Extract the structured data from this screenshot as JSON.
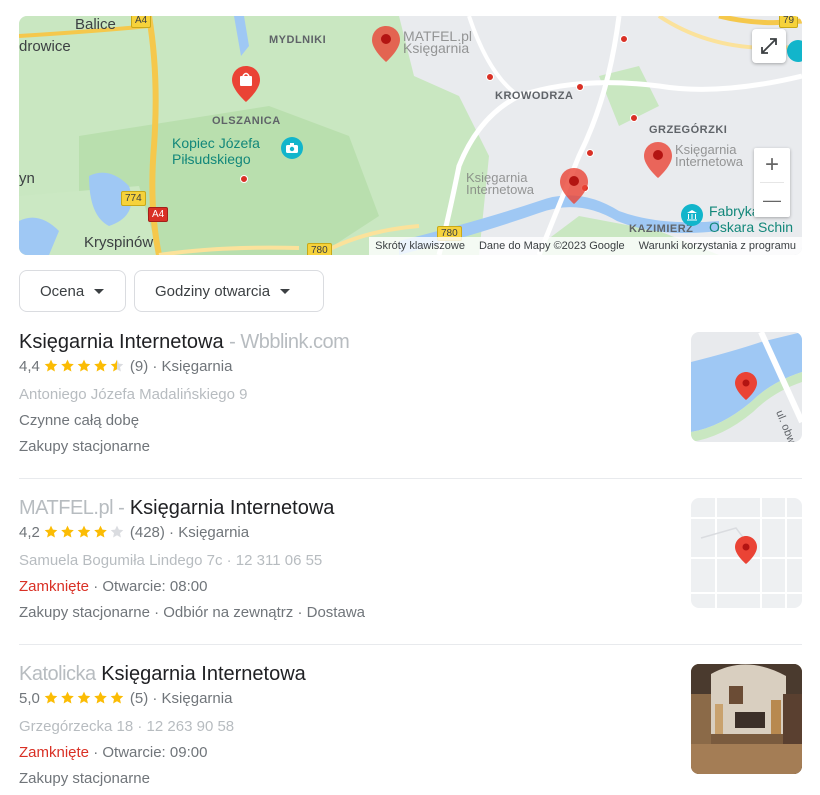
{
  "map": {
    "places": {
      "balice": "Balice",
      "drowice": "drowice",
      "yn": "yn",
      "kryspinow": "Kryspinów",
      "mydlniki": "MYDLNIKI",
      "olszanica": "OLSZANICA",
      "krowodrza": "KROWODRZA",
      "grzegorzki": "GRZEGÓRZKI",
      "kazimierz": "KAZIMIERZ"
    },
    "poi": {
      "kopiec": "Kopiec Józefa\nPiłsudskiego",
      "fabryka": "Fabryka\nOskara Schin"
    },
    "shields": {
      "a4_top": "A4",
      "a4_bottom": "A4",
      "r774": "774",
      "r780a": "780",
      "r780b": "780",
      "r79": "79"
    },
    "blurred_labels": {
      "matfel": "MATFEL.pl\nKsięgarnia",
      "ksiegarnia_center": "Księgarnia\nInternetowa",
      "ksiegarnia_right": "Księgarnia\nInternetowa"
    },
    "attribution": {
      "shortcuts": "Skróty klawiszowe",
      "data": "Dane do Mapy ©2023 Google",
      "terms": "Warunki korzystania z programu"
    },
    "zoom_in": "+",
    "zoom_out": "—"
  },
  "filters": [
    {
      "label": "Ocena"
    },
    {
      "label": "Godziny otwarcia"
    }
  ],
  "results": [
    {
      "title_prefix": "",
      "title_blurred_prefix": "",
      "title": "Księgarnia Internetowa",
      "title_blurred_suffix": "- Wbblink.com",
      "rating": "4,4",
      "stars": 4.5,
      "reviews": "(9)",
      "category": "Księgarnia",
      "address_blurred": "Antoniego Józefa Madalińskiego 9",
      "hours_status": "",
      "hours_text": "Czynne całą dobę",
      "services": "Zakupy stacjonarne"
    },
    {
      "title_blurred_prefix": "MATFEL.pl -",
      "title": "Księgarnia Internetowa",
      "title_blurred_suffix": "",
      "rating": "4,2",
      "stars": 4,
      "reviews": "(428)",
      "category": "Księgarnia",
      "address_blurred": "Samuela Bogumiła Lindego 7c · 12 311 06 55",
      "hours_status": "Zamknięte",
      "hours_text": "· Otwarcie: 08:00",
      "services": "Zakupy stacjonarne · Odbiór na zewnątrz · Dostawa"
    },
    {
      "title_blurred_prefix": "Katolicka",
      "title": "Księgarnia Internetowa",
      "title_blurred_suffix": "",
      "rating": "5,0",
      "stars": 5,
      "reviews": "(5)",
      "category": "Księgarnia",
      "address_blurred": "Grzegórzecka 18 · 12 263 90 58",
      "hours_status": "Zamknięte",
      "hours_text": "· Otwarcie: 09:00",
      "services": "Zakupy stacjonarne"
    }
  ],
  "colors": {
    "star": "#fbbc04",
    "star_empty": "#dadce0",
    "closed": "#d93025",
    "pin": "#ea4335"
  }
}
